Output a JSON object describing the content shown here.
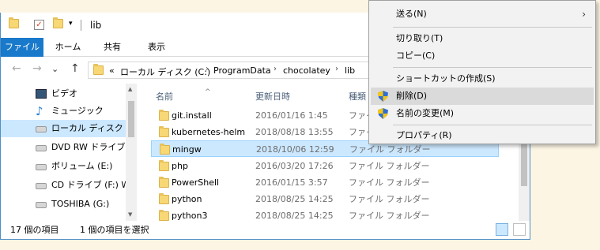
{
  "titlebar": {
    "title": "lib",
    "qa_arrow": "▾"
  },
  "ribbon": {
    "tabs": [
      "ファイル",
      "ホーム",
      "共有",
      "表示"
    ]
  },
  "nav_buttons": {
    "back": "←",
    "forward": "→",
    "recent": "⌄",
    "up": "↑"
  },
  "address": {
    "prefix": "«",
    "crumbs": [
      "ローカル ディスク (C:)",
      "ProgramData",
      "chocolatey",
      "lib"
    ],
    "sep": "›"
  },
  "navpane": {
    "items": [
      {
        "label": "ビデオ",
        "icon": "film-icon"
      },
      {
        "label": "ミュージック",
        "icon": "music-note-icon"
      },
      {
        "label": "ローカル ディスク (C:)",
        "icon": "drive-icon",
        "selected": true
      },
      {
        "label": "DVD RW ドライブ (D",
        "icon": "dvd-drive-icon"
      },
      {
        "label": "ボリューム (E:)",
        "icon": "drive-icon"
      },
      {
        "label": "CD ドライブ (F:) WR",
        "icon": "cd-drive-icon"
      },
      {
        "label": "TOSHIBA (G:)",
        "icon": "drive-icon"
      }
    ]
  },
  "filelist": {
    "headers": {
      "name": "名前",
      "date": "更新日時",
      "type": "種類"
    },
    "sort_caret": "^",
    "rows": [
      {
        "name": "git.install",
        "date": "2016/01/16 1:45",
        "type": "ファイル フォルダー"
      },
      {
        "name": "kubernetes-helm",
        "date": "2018/08/18 13:55",
        "type": "ファイル フォルダー"
      },
      {
        "name": "mingw",
        "date": "2018/10/06 12:59",
        "type": "ファイル フォルダー",
        "selected": true
      },
      {
        "name": "php",
        "date": "2016/03/20 17:26",
        "type": "ファイル フォルダー"
      },
      {
        "name": "PowerShell",
        "date": "2016/01/15 3:57",
        "type": "ファイル フォルダー"
      },
      {
        "name": "python",
        "date": "2018/08/25 14:25",
        "type": "ファイル フォルダー"
      },
      {
        "name": "python3",
        "date": "2018/08/25 14:25",
        "type": "ファイル フォルダー"
      }
    ]
  },
  "status": {
    "count": "17 個の項目",
    "selected": "1 個の項目を選択"
  },
  "context_menu": {
    "items": [
      {
        "label": "送る(N)",
        "submenu": true
      },
      {
        "label": "切り取り(T)"
      },
      {
        "label": "コピー(C)"
      },
      {
        "label": "ショートカットの作成(S)"
      },
      {
        "label": "削除(D)",
        "shield": true,
        "highlighted": true
      },
      {
        "label": "名前の変更(M)",
        "shield": true
      },
      {
        "label": "プロパティ(R)"
      }
    ],
    "submenu_arrow": "›"
  },
  "colors": {
    "accent": "#1979ca",
    "selection": "#cce8ff",
    "folder": "#f8d775"
  }
}
